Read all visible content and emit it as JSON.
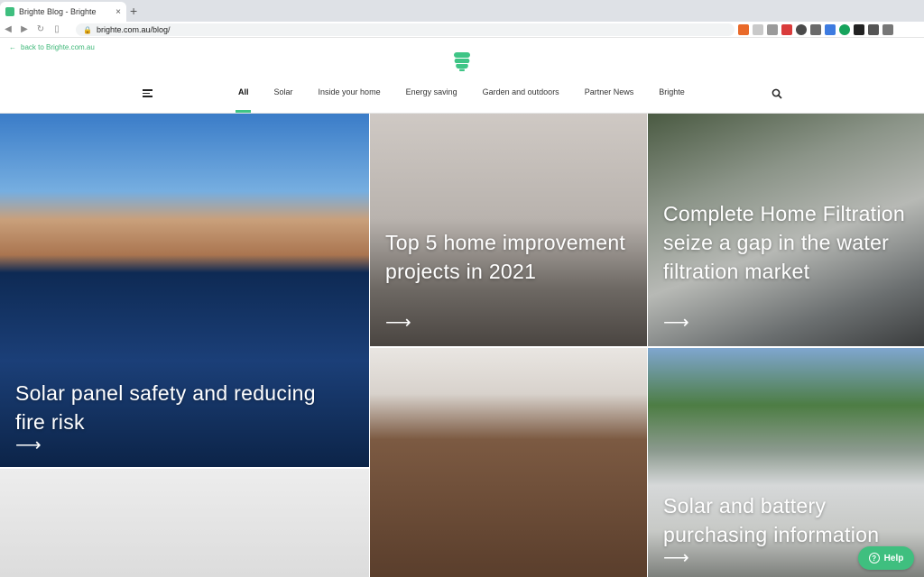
{
  "browser": {
    "tab_title": "Brighte Blog - Brighte",
    "tab_close": "×",
    "new_tab": "+",
    "url": "brighte.com.au/blog/",
    "extensions": [
      "brave-icon",
      "ext-grey-icon",
      "camera-icon",
      "badge-red-icon",
      "block-icon",
      "arrow-icon",
      "translate-icon",
      "grammarly-icon",
      "notion-icon",
      "puzzle-icon",
      "menu-dots-icon"
    ]
  },
  "header": {
    "back_link": "back to Brighte.com.au",
    "nav": [
      "All",
      "Solar",
      "Inside your home",
      "Energy saving",
      "Garden and outdoors",
      "Partner News",
      "Brighte"
    ],
    "active": "All",
    "brand_color": "#3fc586"
  },
  "posts": [
    {
      "title": "Solar panel safety and reducing fire risk",
      "arrow": "⟶"
    },
    {
      "title": "Top 5 home improvement projects in 2021",
      "arrow": "⟶"
    },
    {
      "title": "Complete Home Filtration seize a gap in the water filtration market",
      "arrow": "⟶"
    },
    {
      "title": "",
      "arrow": ""
    },
    {
      "title": "Solar and battery purchasing information",
      "arrow": "⟶"
    }
  ],
  "help": {
    "label": "Help",
    "icon": "?"
  }
}
